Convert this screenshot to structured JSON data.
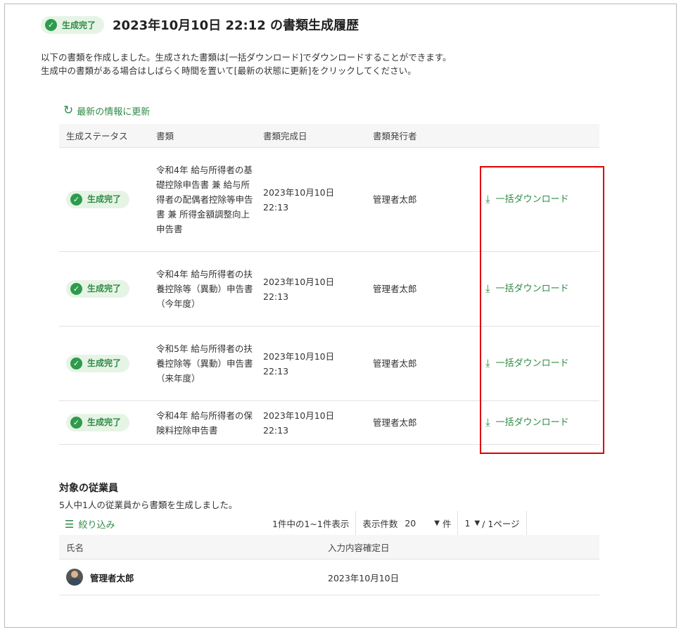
{
  "header": {
    "status_badge": "生成完了",
    "title": "2023年10月10日 22:12 の書類生成履歴"
  },
  "description": {
    "line1": "以下の書類を作成しました。生成された書類は[一括ダウンロード]でダウンロードすることができます。",
    "line2": "生成中の書類がある場合はしばらく時間を置いて[最新の状態に更新]をクリックしてください。"
  },
  "refresh": {
    "label": "最新の情報に更新",
    "icon": "refresh-icon"
  },
  "documents": {
    "columns": [
      "生成ステータス",
      "書類",
      "書類完成日",
      "書類発行者",
      ""
    ],
    "rows": [
      {
        "status": "生成完了",
        "document": "令和4年 給与所得者の基礎控除申告書 兼 給与所得者の配偶者控除等申告書 兼 所得金額調整向上申告書",
        "date": "2023年10月10日",
        "time": "22:13",
        "issuer": "管理者太郎",
        "action": "一括ダウンロード"
      },
      {
        "status": "生成完了",
        "document": "令和4年 給与所得者の扶養控除等（異動）申告書（今年度）",
        "date": "2023年10月10日",
        "time": "22:13",
        "issuer": "管理者太郎",
        "action": "一括ダウンロード"
      },
      {
        "status": "生成完了",
        "document": "令和5年 給与所得者の扶養控除等（異動）申告書（来年度）",
        "date": "2023年10月10日",
        "time": "22:13",
        "issuer": "管理者太郎",
        "action": "一括ダウンロード"
      },
      {
        "status": "生成完了",
        "document": "令和4年 給与所得者の保険料控除申告書",
        "date": "2023年10月10日",
        "time": "22:13",
        "issuer": "管理者太郎",
        "action": "一括ダウンロード"
      }
    ]
  },
  "employees": {
    "title": "対象の従業員",
    "subtitle": "5人中1人の従業員から書類を生成しました。",
    "filter_label": "絞り込み",
    "pager": {
      "range": "1件中の1~1件表示",
      "per_page_label": "表示件数",
      "per_page_value": "20",
      "per_page_unit": "件",
      "page_value": "1",
      "page_total": "/ 1ページ"
    },
    "columns": [
      "氏名",
      "入力内容確定日"
    ],
    "rows": [
      {
        "name": "管理者太郎",
        "confirmed": "2023年10月10日"
      }
    ]
  },
  "colors": {
    "accent": "#2e8b45",
    "highlight": "#e00000"
  }
}
